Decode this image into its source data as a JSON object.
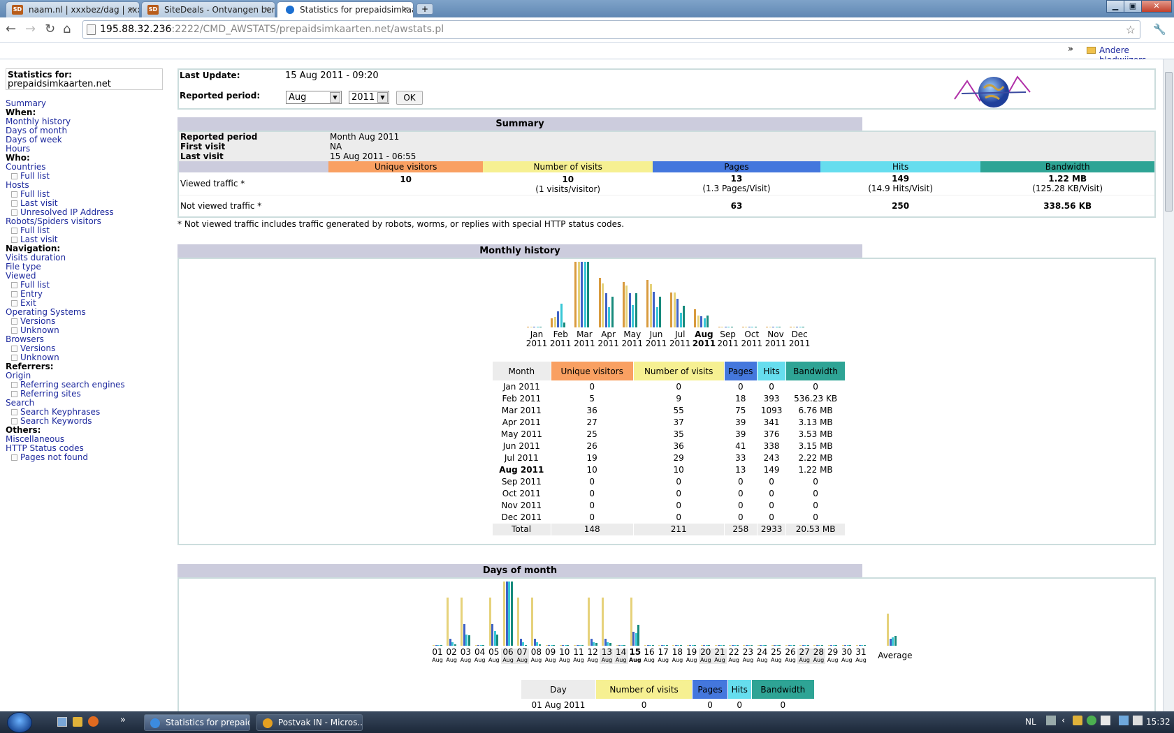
{
  "browser": {
    "tabs": [
      {
        "title": "naam.nl | xxxbez/dag | xxx€"
      },
      {
        "title": "SiteDeals - Ontvangen beric"
      },
      {
        "title": "Statistics for prepaidsimkaa"
      }
    ],
    "url_host": "195.88.32.236",
    "url_rest": ":2222/CMD_AWSTATS/prepaidsimkaarten.net/awstats.pl",
    "bookmarks_other": "Andere bladwijzers",
    "bookmarks_more": "»"
  },
  "menu": {
    "stats_for_label": "Statistics for:",
    "site": "prepaidsimkaarten.net",
    "items": [
      {
        "type": "link",
        "label": "Summary"
      },
      {
        "type": "head",
        "label": "When:"
      },
      {
        "type": "link",
        "label": "Monthly history"
      },
      {
        "type": "link",
        "label": "Days of month"
      },
      {
        "type": "link",
        "label": "Days of week"
      },
      {
        "type": "link",
        "label": "Hours"
      },
      {
        "type": "head",
        "label": "Who:"
      },
      {
        "type": "link",
        "label": "Countries"
      },
      {
        "type": "sub",
        "label": "Full list"
      },
      {
        "type": "link",
        "label": "Hosts"
      },
      {
        "type": "sub",
        "label": "Full list"
      },
      {
        "type": "sub",
        "label": "Last visit"
      },
      {
        "type": "sub",
        "label": "Unresolved IP Address"
      },
      {
        "type": "link",
        "label": "Robots/Spiders visitors"
      },
      {
        "type": "sub",
        "label": "Full list"
      },
      {
        "type": "sub",
        "label": "Last visit"
      },
      {
        "type": "head",
        "label": "Navigation:"
      },
      {
        "type": "link",
        "label": "Visits duration"
      },
      {
        "type": "link",
        "label": "File type"
      },
      {
        "type": "link",
        "label": "Viewed"
      },
      {
        "type": "sub",
        "label": "Full list"
      },
      {
        "type": "sub",
        "label": "Entry"
      },
      {
        "type": "sub",
        "label": "Exit"
      },
      {
        "type": "link",
        "label": "Operating Systems"
      },
      {
        "type": "sub",
        "label": "Versions"
      },
      {
        "type": "sub",
        "label": "Unknown"
      },
      {
        "type": "link",
        "label": "Browsers"
      },
      {
        "type": "sub",
        "label": "Versions"
      },
      {
        "type": "sub",
        "label": "Unknown"
      },
      {
        "type": "head",
        "label": "Referrers:"
      },
      {
        "type": "link",
        "label": "Origin"
      },
      {
        "type": "sub",
        "label": "Referring search engines"
      },
      {
        "type": "sub",
        "label": "Referring sites"
      },
      {
        "type": "link",
        "label": "Search"
      },
      {
        "type": "sub",
        "label": "Search Keyphrases"
      },
      {
        "type": "sub",
        "label": "Search Keywords"
      },
      {
        "type": "head",
        "label": "Others:"
      },
      {
        "type": "link",
        "label": "Miscellaneous"
      },
      {
        "type": "link",
        "label": "HTTP Status codes"
      },
      {
        "type": "sub",
        "label": "Pages not found"
      }
    ]
  },
  "update": {
    "last_update_label": "Last Update:",
    "last_update": "15 Aug 2011 - 09:20",
    "period_label": "Reported period:",
    "month": "Aug",
    "year": "2011",
    "ok": "OK"
  },
  "summary": {
    "title": "Summary",
    "reported_period_label": "Reported period",
    "reported_period": "Month Aug 2011",
    "first_visit_label": "First visit",
    "first_visit": "NA",
    "last_visit_label": "Last visit",
    "last_visit": "15 Aug 2011 - 06:55",
    "cols": [
      "Unique visitors",
      "Number of visits",
      "Pages",
      "Hits",
      "Bandwidth"
    ],
    "viewed_label": "Viewed traffic *",
    "viewed": [
      "10",
      "10",
      "13",
      "149",
      "1.22 MB"
    ],
    "viewed_sub": [
      "",
      "(1 visits/visitor)",
      "(1.3 Pages/Visit)",
      "(14.9 Hits/Visit)",
      "(125.28 KB/Visit)"
    ],
    "notviewed_label": "Not viewed traffic *",
    "notviewed": [
      "63",
      "250",
      "338.56 KB"
    ],
    "note": "* Not viewed traffic includes traffic generated by robots, worms, or replies with special HTTP status codes."
  },
  "monthly": {
    "title": "Monthly history",
    "headers": [
      "Month",
      "Unique visitors",
      "Number of visits",
      "Pages",
      "Hits",
      "Bandwidth"
    ],
    "rows": [
      [
        "Jan 2011",
        "0",
        "0",
        "0",
        "0",
        "0"
      ],
      [
        "Feb 2011",
        "5",
        "9",
        "18",
        "393",
        "536.23 KB"
      ],
      [
        "Mar 2011",
        "36",
        "55",
        "75",
        "1093",
        "6.76 MB"
      ],
      [
        "Apr 2011",
        "27",
        "37",
        "39",
        "341",
        "3.13 MB"
      ],
      [
        "May 2011",
        "25",
        "35",
        "39",
        "376",
        "3.53 MB"
      ],
      [
        "Jun 2011",
        "26",
        "36",
        "41",
        "338",
        "3.15 MB"
      ],
      [
        "Jul 2011",
        "19",
        "29",
        "33",
        "243",
        "2.22 MB"
      ],
      [
        "Aug 2011",
        "10",
        "10",
        "13",
        "149",
        "1.22 MB"
      ],
      [
        "Sep 2011",
        "0",
        "0",
        "0",
        "0",
        "0"
      ],
      [
        "Oct 2011",
        "0",
        "0",
        "0",
        "0",
        "0"
      ],
      [
        "Nov 2011",
        "0",
        "0",
        "0",
        "0",
        "0"
      ],
      [
        "Dec 2011",
        "0",
        "0",
        "0",
        "0",
        "0"
      ]
    ],
    "total": [
      "Total",
      "148",
      "211",
      "258",
      "2933",
      "20.53 MB"
    ]
  },
  "chart_data": [
    {
      "type": "bar",
      "categories": [
        "Jan 2011",
        "Feb 2011",
        "Mar 2011",
        "Apr 2011",
        "May 2011",
        "Jun 2011",
        "Jul 2011",
        "Aug 2011",
        "Sep 2011",
        "Oct 2011",
        "Nov 2011",
        "Dec 2011"
      ],
      "series": [
        {
          "name": "Unique visitors",
          "values": [
            0,
            5,
            36,
            27,
            25,
            26,
            19,
            10,
            0,
            0,
            0,
            0
          ]
        },
        {
          "name": "Number of visits",
          "values": [
            0,
            9,
            55,
            37,
            35,
            36,
            29,
            10,
            0,
            0,
            0,
            0
          ]
        },
        {
          "name": "Pages",
          "values": [
            0,
            18,
            75,
            39,
            39,
            41,
            33,
            13,
            0,
            0,
            0,
            0
          ]
        },
        {
          "name": "Hits",
          "values": [
            0,
            393,
            1093,
            341,
            376,
            338,
            243,
            149,
            0,
            0,
            0,
            0
          ]
        },
        {
          "name": "Bandwidth",
          "values": [
            0,
            536.23,
            6920,
            3205,
            3615,
            3226,
            2273,
            1249,
            0,
            0,
            0,
            0
          ]
        }
      ]
    },
    {
      "type": "bar",
      "categories": [
        "01",
        "02",
        "03",
        "04",
        "05",
        "06",
        "07",
        "08",
        "09",
        "10",
        "11",
        "12",
        "13",
        "14",
        "15",
        "16",
        "17",
        "18",
        "19",
        "20",
        "21",
        "22",
        "23",
        "24",
        "25",
        "26",
        "27",
        "28",
        "29",
        "30",
        "31",
        "Average"
      ],
      "series": [
        {
          "name": "Number of visits",
          "values": [
            0,
            3,
            3,
            0,
            3,
            4,
            3,
            3,
            0,
            0,
            0,
            3,
            3,
            0,
            3,
            0,
            0,
            0,
            0,
            0,
            0,
            0,
            0,
            0,
            0,
            0,
            0,
            0,
            0,
            0,
            0,
            2
          ]
        },
        {
          "name": "Pages",
          "values": [
            0,
            1,
            3,
            0,
            3,
            9,
            1,
            1,
            0,
            0,
            0,
            1,
            1,
            0,
            2,
            0,
            0,
            0,
            0,
            0,
            0,
            0,
            0,
            0,
            0,
            0,
            0,
            0,
            0,
            0,
            0,
            1
          ]
        },
        {
          "name": "Hits",
          "values": [
            0,
            2,
            7,
            0,
            9,
            40,
            2,
            2,
            0,
            0,
            0,
            2,
            2,
            0,
            8,
            0,
            0,
            0,
            0,
            0,
            0,
            0,
            0,
            0,
            0,
            0,
            0,
            0,
            0,
            0,
            0,
            5
          ]
        },
        {
          "name": "Bandwidth",
          "values": [
            0,
            2,
            14,
            0,
            15,
            87,
            1,
            2,
            0,
            0,
            0,
            4,
            4,
            0,
            28,
            0,
            0,
            0,
            0,
            0,
            0,
            0,
            0,
            0,
            0,
            0,
            0,
            0,
            0,
            0,
            0,
            13
          ]
        }
      ]
    }
  ],
  "days": {
    "title": "Days of month",
    "labels": [
      "01",
      "02",
      "03",
      "04",
      "05",
      "06",
      "07",
      "08",
      "09",
      "10",
      "11",
      "12",
      "13",
      "14",
      "15",
      "16",
      "17",
      "18",
      "19",
      "20",
      "21",
      "22",
      "23",
      "24",
      "25",
      "26",
      "27",
      "28",
      "29",
      "30",
      "31"
    ],
    "sub": "Aug",
    "average": "Average",
    "headers": [
      "Day",
      "Number of visits",
      "Pages",
      "Hits",
      "Bandwidth"
    ],
    "first_row": [
      "01 Aug 2011",
      "0",
      "0",
      "0",
      "0"
    ]
  },
  "taskbar": {
    "items": [
      "Statistics for prepaid...",
      "Postvak IN - Micros..."
    ],
    "lang": "NL",
    "clock": "15:32"
  }
}
